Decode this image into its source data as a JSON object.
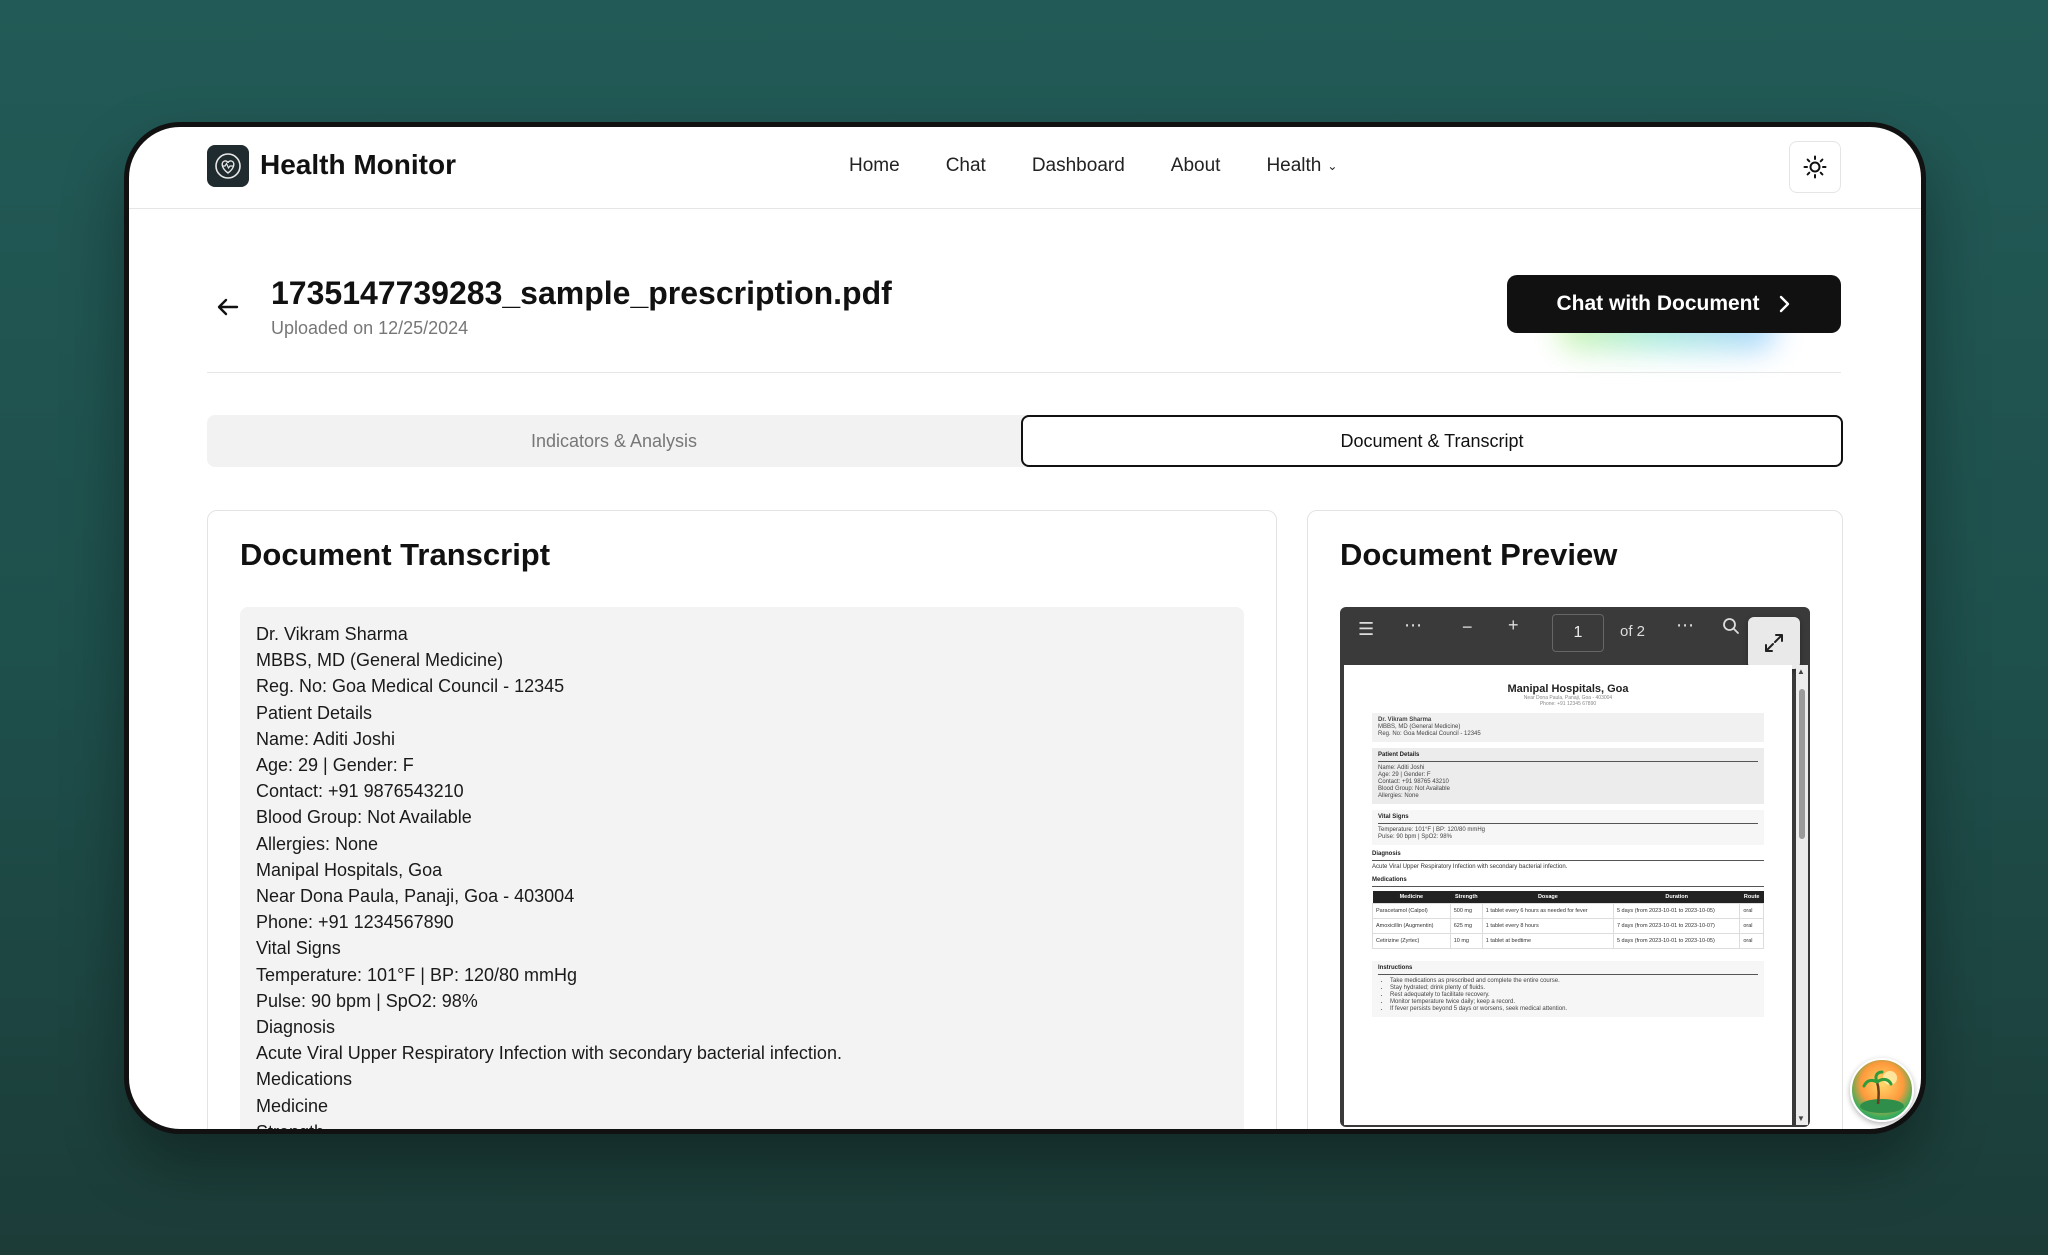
{
  "nav": {
    "brand": "Health Monitor",
    "links": [
      "Home",
      "Chat",
      "Dashboard",
      "About",
      "Health"
    ]
  },
  "header": {
    "title": "1735147739283_sample_prescription.pdf",
    "uploaded": "Uploaded on 12/25/2024",
    "chat_button": "Chat with Document"
  },
  "tabs": {
    "indicators": "Indicators & Analysis",
    "document": "Document & Transcript"
  },
  "transcript": {
    "title": "Document Transcript",
    "lines": [
      "Dr. Vikram Sharma",
      "MBBS, MD (General Medicine)",
      "Reg. No: Goa Medical Council - 12345",
      "Patient Details",
      "Name: Aditi Joshi",
      "Age: 29 | Gender: F",
      "Contact: +91 9876543210",
      "Blood Group: Not Available",
      "Allergies: None",
      "Manipal Hospitals, Goa",
      "Near Dona Paula, Panaji, Goa - 403004",
      "Phone: +91 1234567890",
      "Vital Signs",
      "Temperature: 101°F | BP: 120/80 mmHg",
      "Pulse: 90 bpm | SpO2: 98%",
      "Diagnosis",
      "Acute Viral Upper Respiratory Infection with secondary bacterial infection.",
      "Medications",
      "Medicine",
      "Strength"
    ]
  },
  "preview": {
    "title": "Document Preview",
    "page": "1",
    "of_total": "of 2",
    "pdf": {
      "hospital": "Manipal Hospitals, Goa",
      "address": "Near Dona Paula, Panaji, Goa - 403004",
      "phone": "Phone: +91 12345 67890",
      "doctor": [
        "Dr. Vikram Sharma",
        "MBBS, MD (General Medicine)",
        "Reg. No: Goa Medical Council - 12345"
      ],
      "patient_label": "Patient Details",
      "patient": [
        "Name: Aditi Joshi",
        "Age: 29 | Gender: F",
        "Contact: +91 98765 43210",
        "Blood Group: Not Available",
        "Allergies: None"
      ],
      "vitals_label": "Vital Signs",
      "vitals": [
        "Temperature: 101°F | BP: 120/80 mmHg",
        "Pulse: 90 bpm | SpO2: 98%"
      ],
      "diagnosis_label": "Diagnosis",
      "diagnosis": "Acute Viral Upper Respiratory Infection with secondary bacterial infection.",
      "medications_label": "Medications",
      "med_headers": [
        "Medicine",
        "Strength",
        "Dosage",
        "Duration",
        "Route"
      ],
      "med_rows": [
        [
          "Paracetamol (Calpol)",
          "500 mg",
          "1 tablet every 6 hours as needed for fever",
          "5 days (from 2023-10-01 to 2023-10-05)",
          "oral"
        ],
        [
          "Amoxicillin (Augmentin)",
          "625 mg",
          "1 tablet every 8 hours",
          "7 days (from 2023-10-01 to 2023-10-07)",
          "oral"
        ],
        [
          "Cetirizine (Zyrtec)",
          "10 mg",
          "1 tablet at bedtime",
          "5 days (from 2023-10-01 to 2023-10-05)",
          "oral"
        ]
      ],
      "instructions_label": "Instructions",
      "instructions": [
        "Take medications as prescribed and complete the entire course.",
        "Stay hydrated; drink plenty of fluids.",
        "Rest adequately to facilitate recovery.",
        "Monitor temperature twice daily; keep a record.",
        "If fever persists beyond 5 days or worsens, seek medical attention."
      ]
    }
  },
  "colors": {
    "accent": "#111111",
    "background": "#225a57"
  }
}
